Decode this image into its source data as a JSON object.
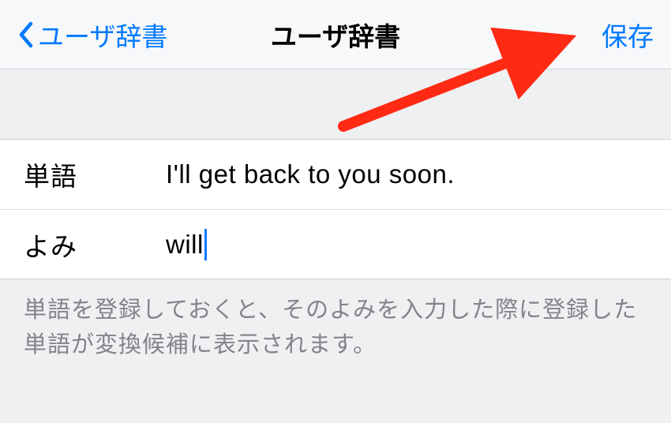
{
  "nav": {
    "back_label": "ユーザ辞書",
    "title": "ユーザ辞書",
    "save_label": "保存"
  },
  "form": {
    "word_label": "単語",
    "word_value": "I'll get back to you soon.",
    "reading_label": "よみ",
    "reading_value": "will"
  },
  "footer": {
    "hint": "単語を登録しておくと、そのよみを入力した際に登録した単語が変換候補に表示されます。"
  },
  "colors": {
    "accent": "#0079ff",
    "arrow": "#ff2a14"
  }
}
